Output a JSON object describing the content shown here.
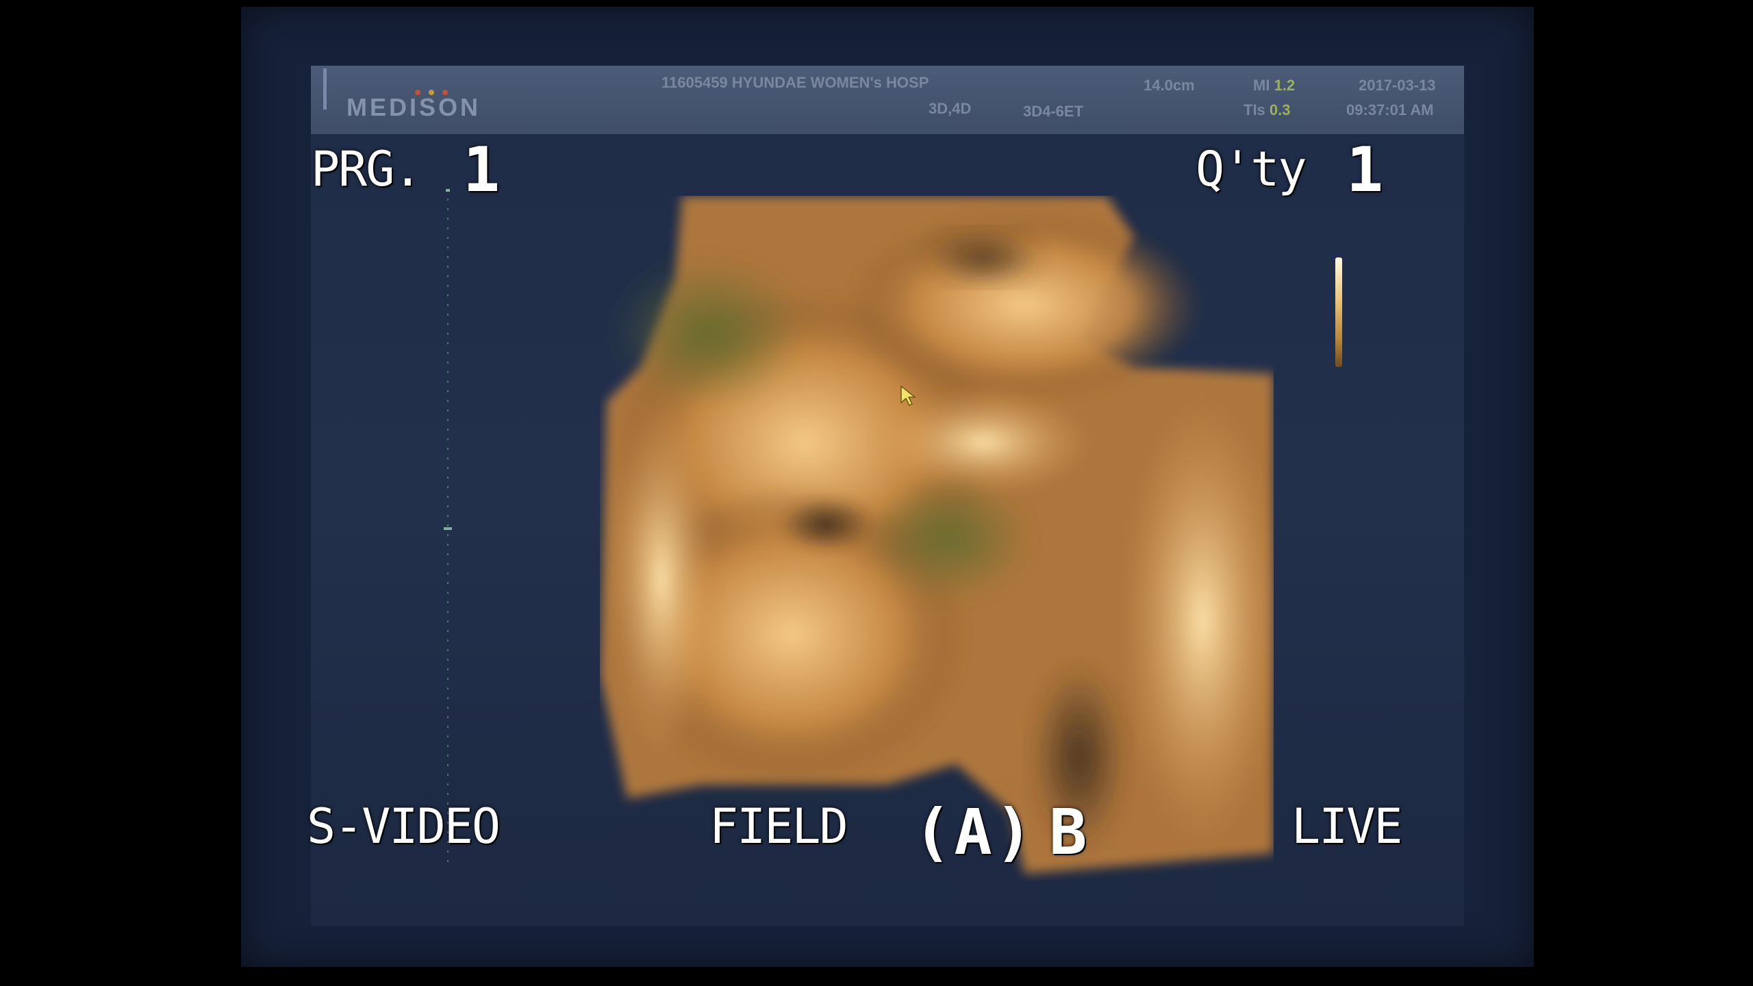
{
  "header": {
    "brand": "MEDISON",
    "patient_and_hospital": "11605459  HYUNDAE WOMEN's HOSP",
    "mode": "3D,4D",
    "probe": "3D4-6ET",
    "depth": "14.0cm",
    "mi_label": "MI",
    "mi_value": "1.2",
    "tis_label": "TIs",
    "tis_value": "0.3",
    "date": "2017-03-13",
    "time": "09:37:01 AM",
    "brand_dot_colors": [
      "#c0523a",
      "#c79a3c",
      "#c0523a"
    ]
  },
  "overlay": {
    "prg_label": "PRG.",
    "prg_value": "1",
    "qty_label": "Q'ty",
    "qty_value": "1",
    "video_source": "S-VIDEO",
    "field_label": "FIELD",
    "field_option_a": "(A)",
    "field_option_b": "B",
    "status": "LIVE"
  },
  "image": {
    "subject": "3D rendered fetal ultrasound volume",
    "tint_colors": [
      "#f2c27a",
      "#d3924a",
      "#8a5a2a",
      "#5e6b2c"
    ]
  },
  "icons": {
    "cursor": "pointer-arrow-icon",
    "gray_scale_bar": "gray-scale-bar-icon",
    "depth_ruler": "depth-ruler-icon"
  }
}
